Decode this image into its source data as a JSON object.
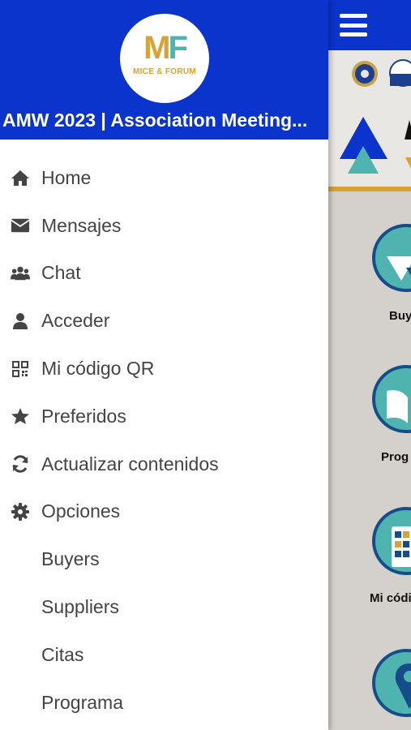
{
  "drawer": {
    "header": {
      "logo_text": "MICE & FORUM",
      "logo_letters": "MF",
      "title": "AMW 2023 | Association Meeting..."
    },
    "menu": [
      {
        "label": "Home",
        "icon": "home-icon"
      },
      {
        "label": "Mensajes",
        "icon": "envelope-icon"
      },
      {
        "label": "Chat",
        "icon": "users-icon"
      },
      {
        "label": "Acceder",
        "icon": "user-icon"
      },
      {
        "label": "Mi código QR",
        "icon": "qr-code-icon"
      },
      {
        "label": "Preferidos",
        "icon": "star-icon"
      },
      {
        "label": "Actualizar contenidos",
        "icon": "refresh-icon"
      },
      {
        "label": "Opciones",
        "icon": "gear-icon"
      },
      {
        "label": "Buyers"
      },
      {
        "label": "Suppliers"
      },
      {
        "label": "Citas"
      },
      {
        "label": "Programa"
      }
    ]
  },
  "app": {
    "tiles": [
      {
        "label": "Buy"
      },
      {
        "label": "Prog"
      },
      {
        "label": "Mi códi"
      }
    ]
  },
  "colors": {
    "header_blue": "#0a34cc",
    "teal": "#4fb3b0",
    "navy": "#154c8a",
    "gold": "#d8a332",
    "menu_text": "#444444",
    "content_bg": "#d4d1cc"
  }
}
